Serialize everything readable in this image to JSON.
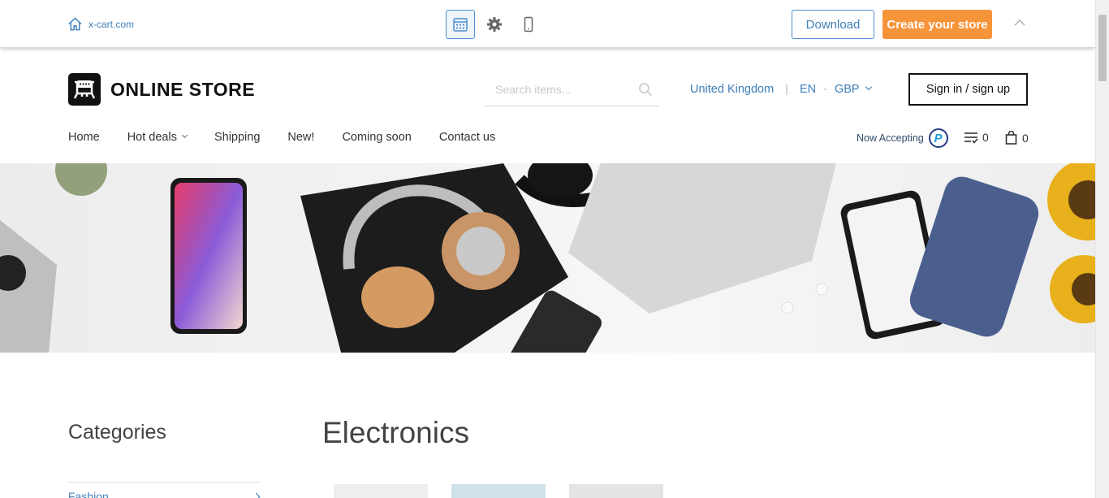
{
  "demo_bar": {
    "home_link": "x-cart.com",
    "download_label": "Download",
    "create_store_label": "Create your store",
    "colors": {
      "accent_blue": "#3f7fb8",
      "orange": "#f6943a"
    }
  },
  "header": {
    "logo_text": "ONLINE STORE",
    "search_placeholder": "Search items...",
    "country": "United Kingdom",
    "language": "EN",
    "currency": "GBP",
    "signin_label": "Sign in / sign up"
  },
  "nav": {
    "items": [
      "Home",
      "Hot deals",
      "Shipping",
      "New!",
      "Coming soon",
      "Contact us"
    ],
    "now_accepting": "Now Accepting",
    "compare_count": "0",
    "cart_count": "0"
  },
  "main": {
    "categories_title": "Categories",
    "first_category": "Fashion",
    "section_title": "Electronics"
  }
}
